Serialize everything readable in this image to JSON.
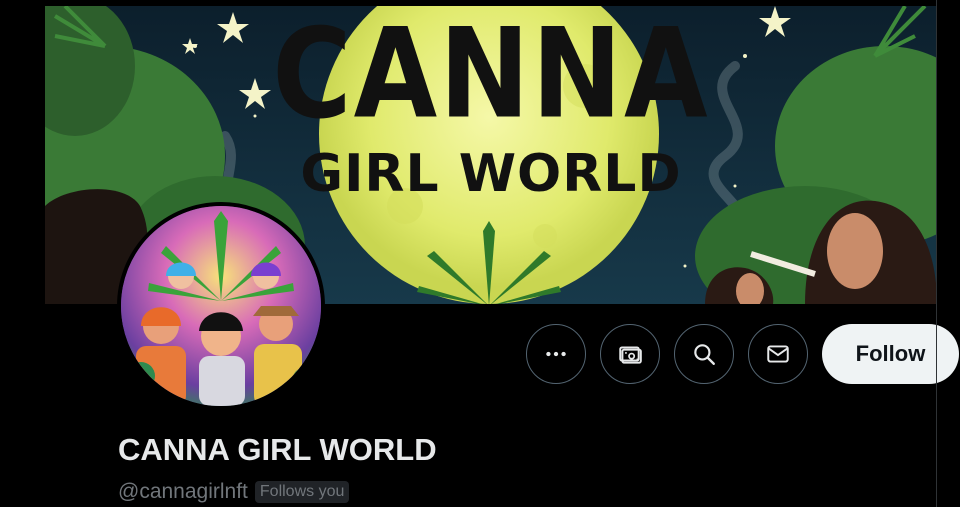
{
  "banner": {
    "title_line1": "CANNA",
    "title_line2": "GIRL WORLD"
  },
  "profile": {
    "display_name": "CANNA GIRL WORLD",
    "handle": "@cannagirlnft",
    "follows_you_badge": "Follows you"
  },
  "actions": {
    "more_icon": "more-horizontal-icon",
    "subscribe_icon": "money-icon",
    "search_icon": "search-icon",
    "message_icon": "envelope-icon",
    "follow_label": "Follow"
  },
  "colors": {
    "background": "#000000",
    "text_primary": "#e7e9ea",
    "text_secondary": "#71767b",
    "button_light": "#eff3f4",
    "moon": "#e6ef7a"
  }
}
